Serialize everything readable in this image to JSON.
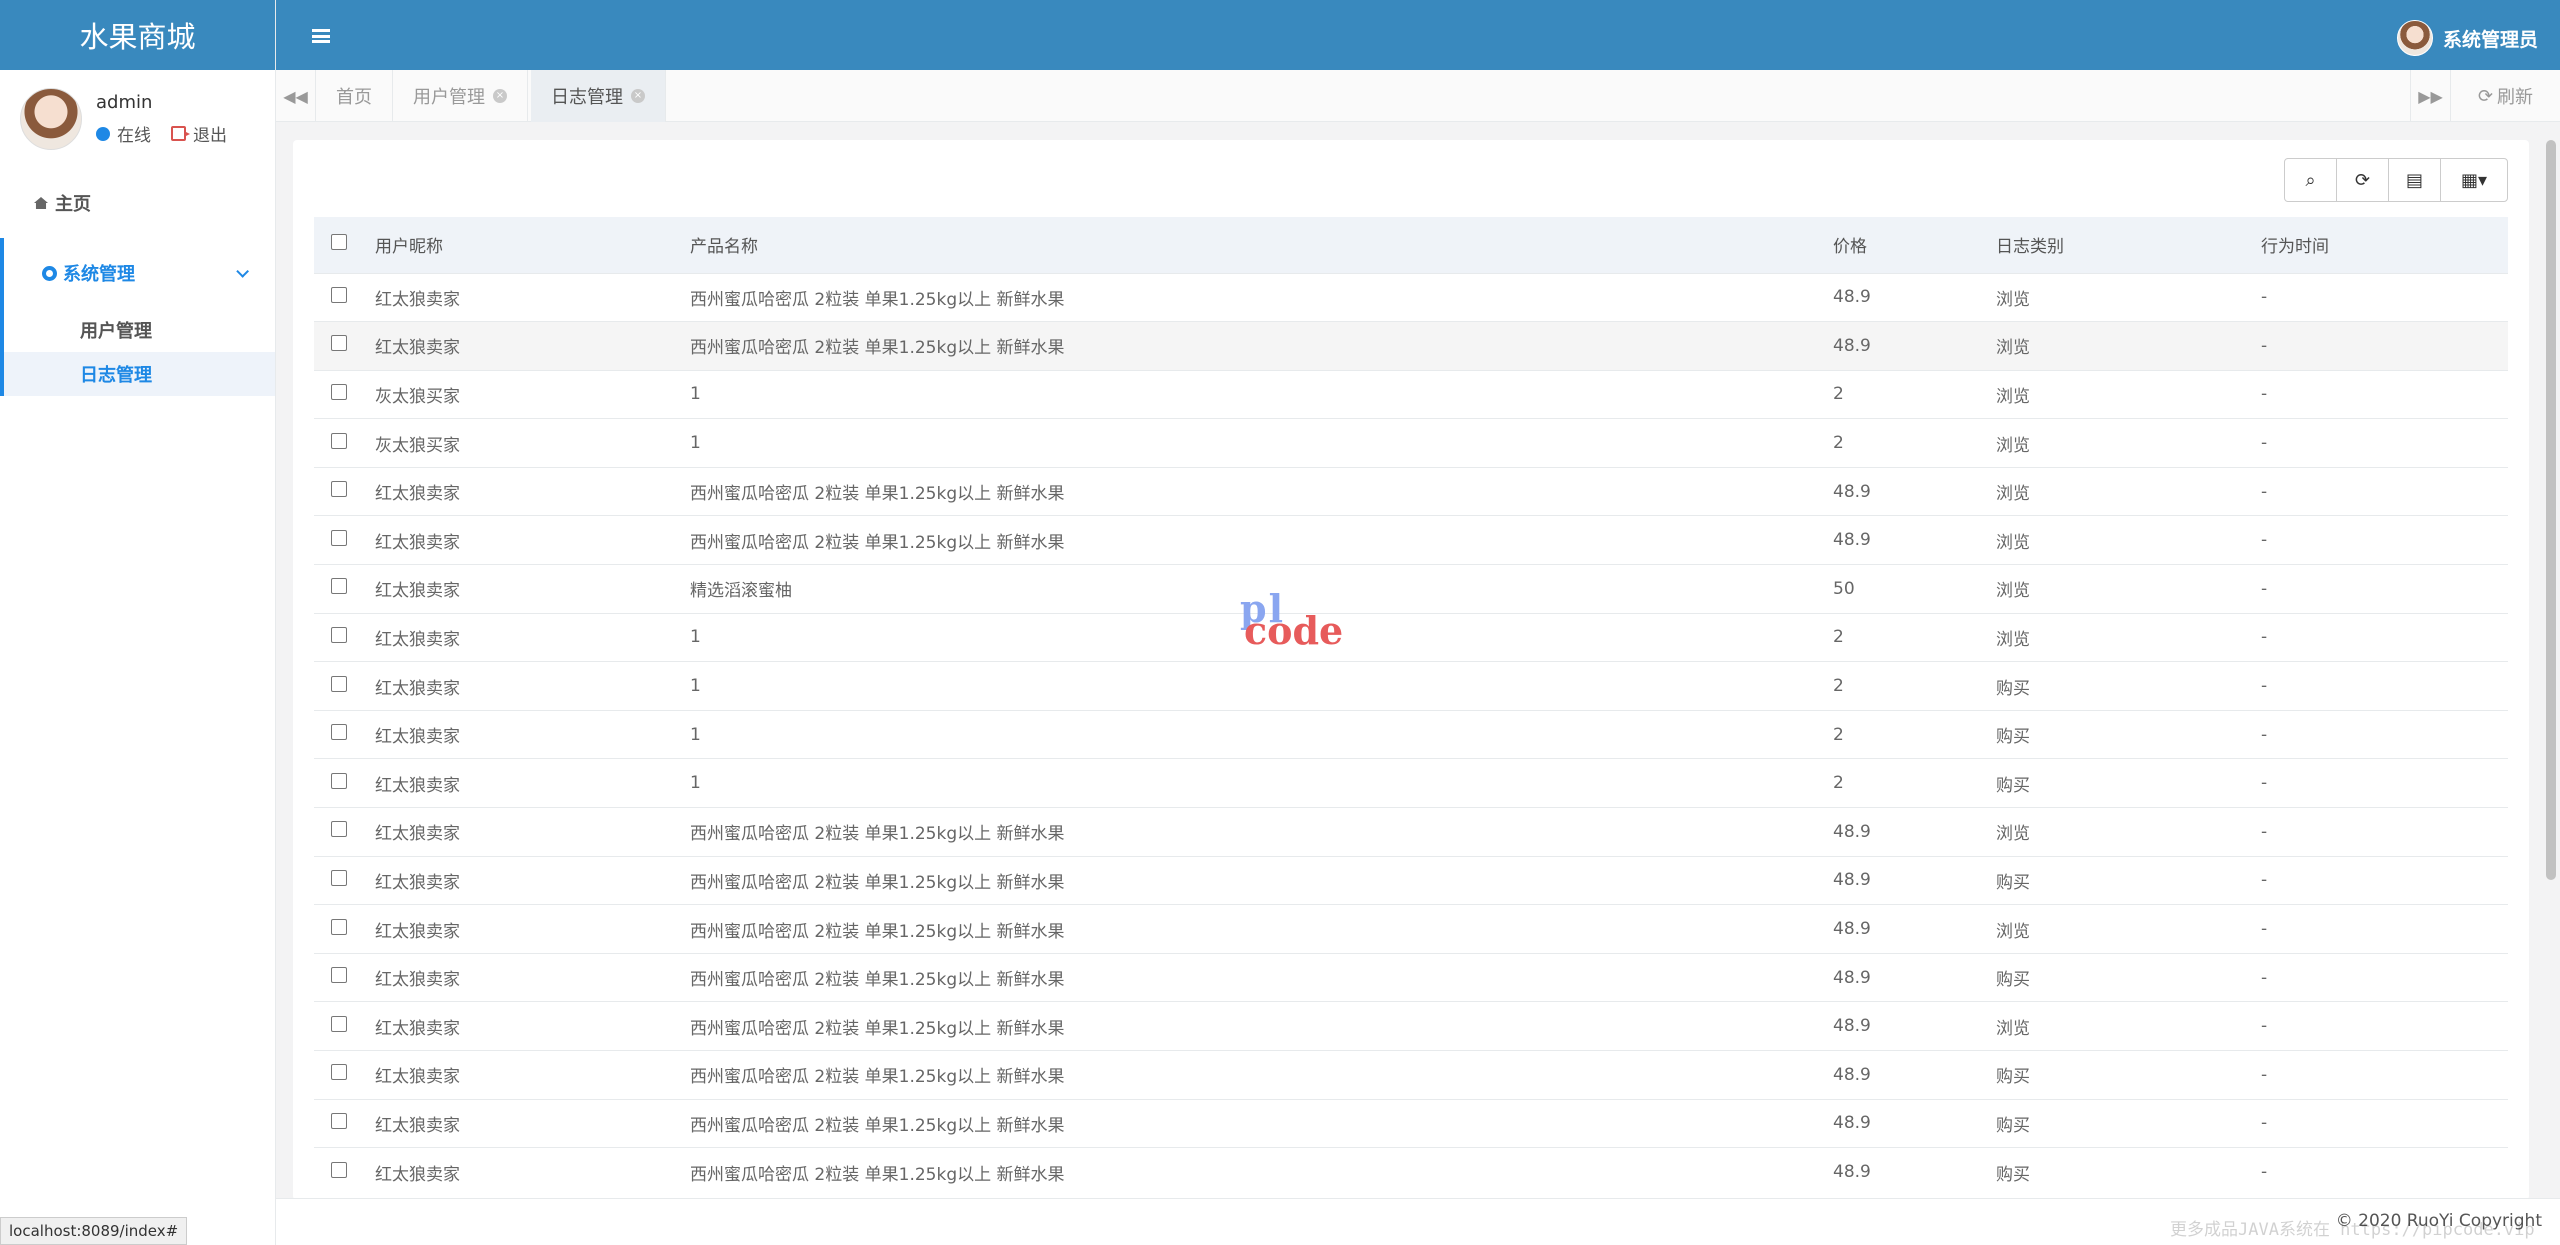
{
  "brand": "水果商城",
  "user": {
    "name": "admin",
    "online": "在线",
    "logout": "退出"
  },
  "nav": {
    "home": "主页",
    "group": "系统管理",
    "items": [
      "用户管理",
      "日志管理"
    ]
  },
  "topbar": {
    "user": "系统管理员"
  },
  "tabs": [
    {
      "label": "首页"
    },
    {
      "label": "用户管理"
    },
    {
      "label": "日志管理"
    }
  ],
  "refresh": "刷新",
  "table": {
    "headers": [
      "用户昵称",
      "产品名称",
      "价格",
      "日志类别",
      "行为时间"
    ],
    "rows": [
      [
        "红太狼卖家",
        "西州蜜瓜哈密瓜 2粒装 单果1.25kg以上 新鲜水果",
        "48.9",
        "浏览",
        "-"
      ],
      [
        "红太狼卖家",
        "西州蜜瓜哈密瓜 2粒装 单果1.25kg以上 新鲜水果",
        "48.9",
        "浏览",
        "-"
      ],
      [
        "灰太狼买家",
        "1",
        "2",
        "浏览",
        "-"
      ],
      [
        "灰太狼买家",
        "1",
        "2",
        "浏览",
        "-"
      ],
      [
        "红太狼卖家",
        "西州蜜瓜哈密瓜 2粒装 单果1.25kg以上 新鲜水果",
        "48.9",
        "浏览",
        "-"
      ],
      [
        "红太狼卖家",
        "西州蜜瓜哈密瓜 2粒装 单果1.25kg以上 新鲜水果",
        "48.9",
        "浏览",
        "-"
      ],
      [
        "红太狼卖家",
        "精选滔滚蜜柚",
        "50",
        "浏览",
        "-"
      ],
      [
        "红太狼卖家",
        "1",
        "2",
        "浏览",
        "-"
      ],
      [
        "红太狼卖家",
        "1",
        "2",
        "购买",
        "-"
      ],
      [
        "红太狼卖家",
        "1",
        "2",
        "购买",
        "-"
      ],
      [
        "红太狼卖家",
        "1",
        "2",
        "购买",
        "-"
      ],
      [
        "红太狼卖家",
        "西州蜜瓜哈密瓜 2粒装 单果1.25kg以上 新鲜水果",
        "48.9",
        "浏览",
        "-"
      ],
      [
        "红太狼卖家",
        "西州蜜瓜哈密瓜 2粒装 单果1.25kg以上 新鲜水果",
        "48.9",
        "购买",
        "-"
      ],
      [
        "红太狼卖家",
        "西州蜜瓜哈密瓜 2粒装 单果1.25kg以上 新鲜水果",
        "48.9",
        "浏览",
        "-"
      ],
      [
        "红太狼卖家",
        "西州蜜瓜哈密瓜 2粒装 单果1.25kg以上 新鲜水果",
        "48.9",
        "购买",
        "-"
      ],
      [
        "红太狼卖家",
        "西州蜜瓜哈密瓜 2粒装 单果1.25kg以上 新鲜水果",
        "48.9",
        "浏览",
        "-"
      ],
      [
        "红太狼卖家",
        "西州蜜瓜哈密瓜 2粒装 单果1.25kg以上 新鲜水果",
        "48.9",
        "购买",
        "-"
      ],
      [
        "红太狼卖家",
        "西州蜜瓜哈密瓜 2粒装 单果1.25kg以上 新鲜水果",
        "48.9",
        "购买",
        "-"
      ],
      [
        "红太狼卖家",
        "西州蜜瓜哈密瓜 2粒装 单果1.25kg以上 新鲜水果",
        "48.9",
        "购买",
        "-"
      ]
    ]
  },
  "watermark": {
    "top": "pl",
    "bottom": "code"
  },
  "footer": {
    "copyright": "© 2020 RuoYi Copyright",
    "overlay": "更多成品JAVA系统在 https://pipcode.vip"
  },
  "status_url": "localhost:8089/index#",
  "colors": {
    "brand_blue": "#3989be",
    "accent": "#1e88e5"
  }
}
